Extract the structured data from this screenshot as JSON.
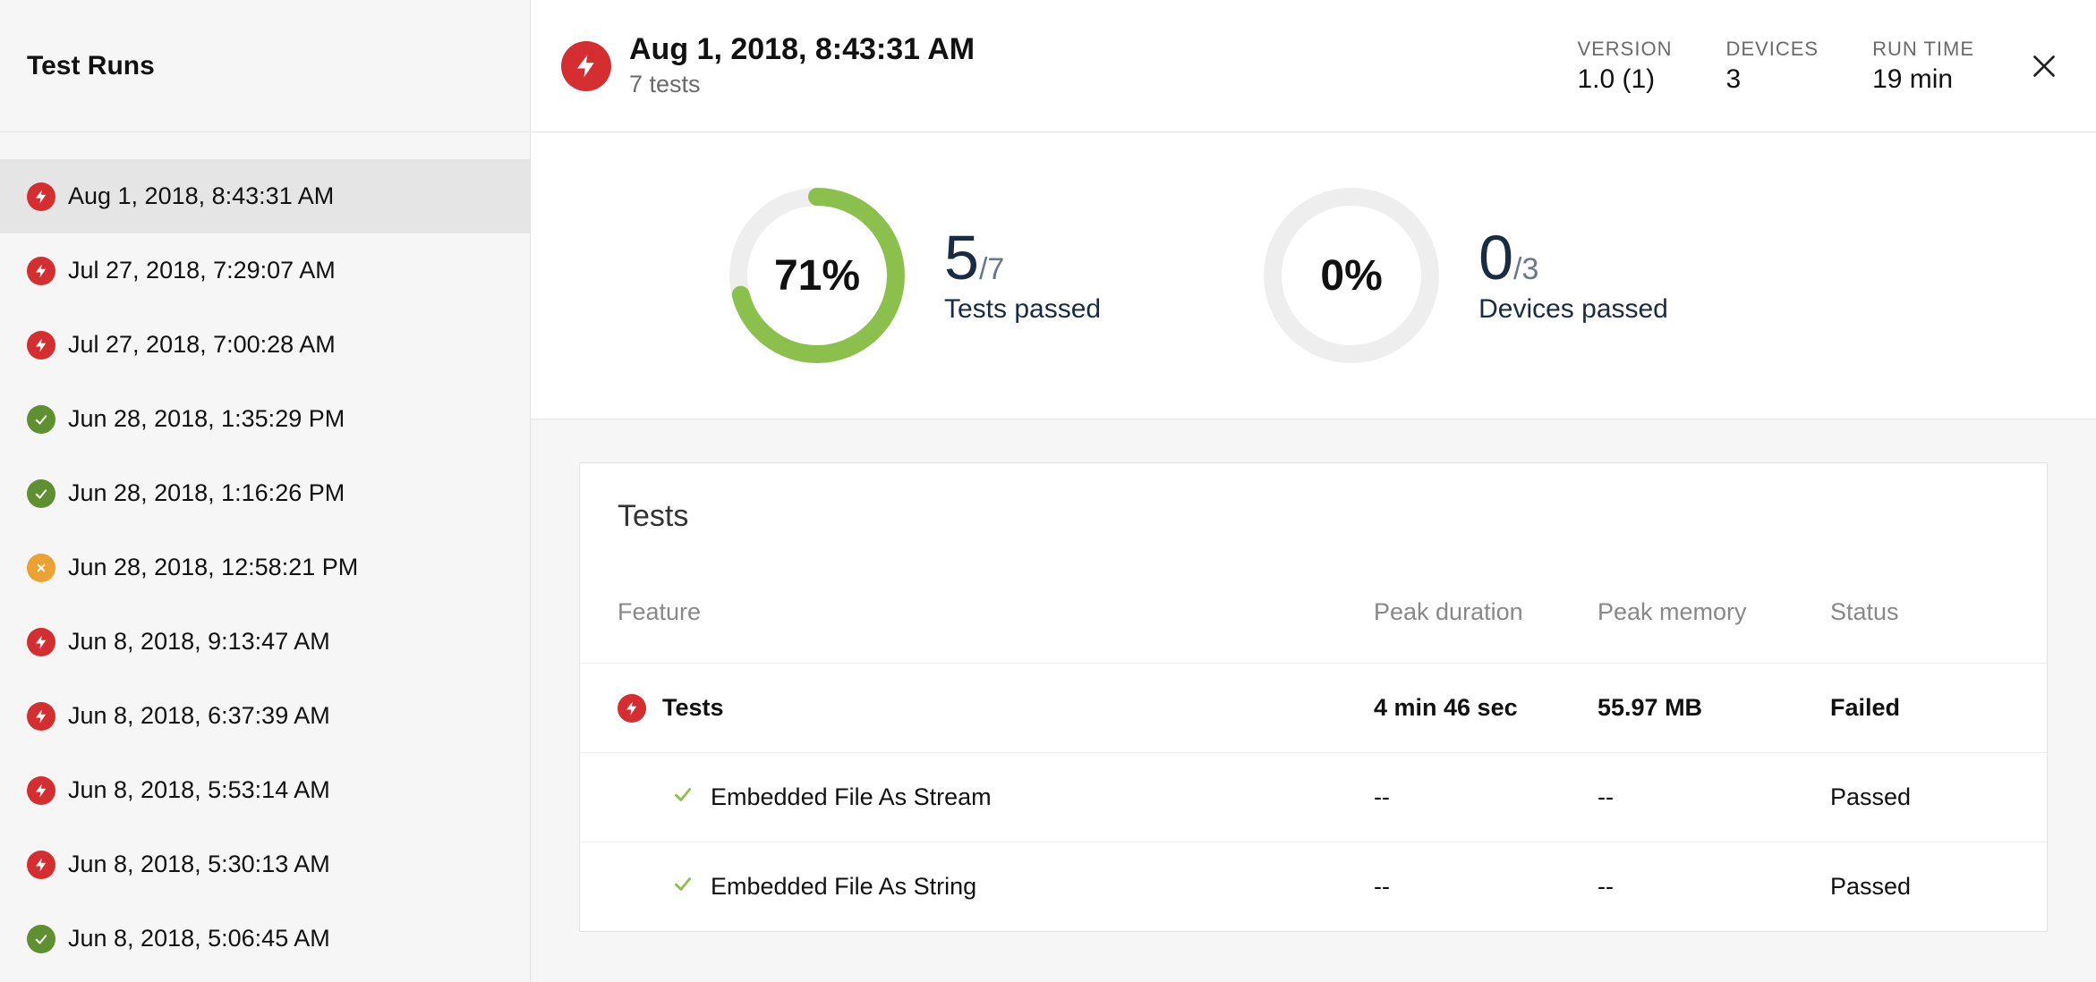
{
  "sidebar": {
    "title": "Test Runs",
    "items": [
      {
        "label": "Aug 1, 2018, 8:43:31 AM",
        "status": "fail",
        "selected": true
      },
      {
        "label": "Jul 27, 2018, 7:29:07 AM",
        "status": "fail",
        "selected": false
      },
      {
        "label": "Jul 27, 2018, 7:00:28 AM",
        "status": "fail",
        "selected": false
      },
      {
        "label": "Jun 28, 2018, 1:35:29 PM",
        "status": "pass",
        "selected": false
      },
      {
        "label": "Jun 28, 2018, 1:16:26 PM",
        "status": "pass",
        "selected": false
      },
      {
        "label": "Jun 28, 2018, 12:58:21 PM",
        "status": "warn",
        "selected": false
      },
      {
        "label": "Jun 8, 2018, 9:13:47 AM",
        "status": "fail",
        "selected": false
      },
      {
        "label": "Jun 8, 2018, 6:37:39 AM",
        "status": "fail",
        "selected": false
      },
      {
        "label": "Jun 8, 2018, 5:53:14 AM",
        "status": "fail",
        "selected": false
      },
      {
        "label": "Jun 8, 2018, 5:30:13 AM",
        "status": "fail",
        "selected": false
      },
      {
        "label": "Jun 8, 2018, 5:06:45 AM",
        "status": "pass",
        "selected": false
      }
    ]
  },
  "header": {
    "title": "Aug 1, 2018, 8:43:31 AM",
    "subtitle": "7 tests",
    "stats": [
      {
        "label": "VERSION",
        "value": "1.0 (1)"
      },
      {
        "label": "DEVICES",
        "value": "3"
      },
      {
        "label": "RUN TIME",
        "value": "19 min"
      }
    ]
  },
  "summary": {
    "tests": {
      "percent": 71,
      "passed": 5,
      "total": 7,
      "caption": "Tests passed"
    },
    "devices": {
      "percent": 0,
      "passed": 0,
      "total": 3,
      "caption": "Devices passed"
    }
  },
  "colors": {
    "dial_ring_bg": "#eeeeee",
    "dial_ring_fg": "#8cc04d",
    "dial_ring_zero": "#e2e2e2",
    "fail": "#d52e31",
    "pass_check": "#8cc04d"
  },
  "tests_table": {
    "title": "Tests",
    "columns": [
      "Feature",
      "Peak duration",
      "Peak memory",
      "Status"
    ],
    "rows": [
      {
        "kind": "parent",
        "icon": "fail",
        "feature": "Tests",
        "peak_duration": "4 min 46 sec",
        "peak_memory": "55.97 MB",
        "status": "Failed"
      },
      {
        "kind": "child",
        "icon": "check",
        "feature": "Embedded File As Stream",
        "peak_duration": "--",
        "peak_memory": "--",
        "status": "Passed"
      },
      {
        "kind": "child",
        "icon": "check",
        "feature": "Embedded File As String",
        "peak_duration": "--",
        "peak_memory": "--",
        "status": "Passed"
      }
    ]
  },
  "chart_data": [
    {
      "type": "pie",
      "title": "Tests passed",
      "categories": [
        "passed",
        "remaining"
      ],
      "values": [
        5,
        2
      ],
      "percent": 71
    },
    {
      "type": "pie",
      "title": "Devices passed",
      "categories": [
        "passed",
        "remaining"
      ],
      "values": [
        0,
        3
      ],
      "percent": 0
    }
  ]
}
